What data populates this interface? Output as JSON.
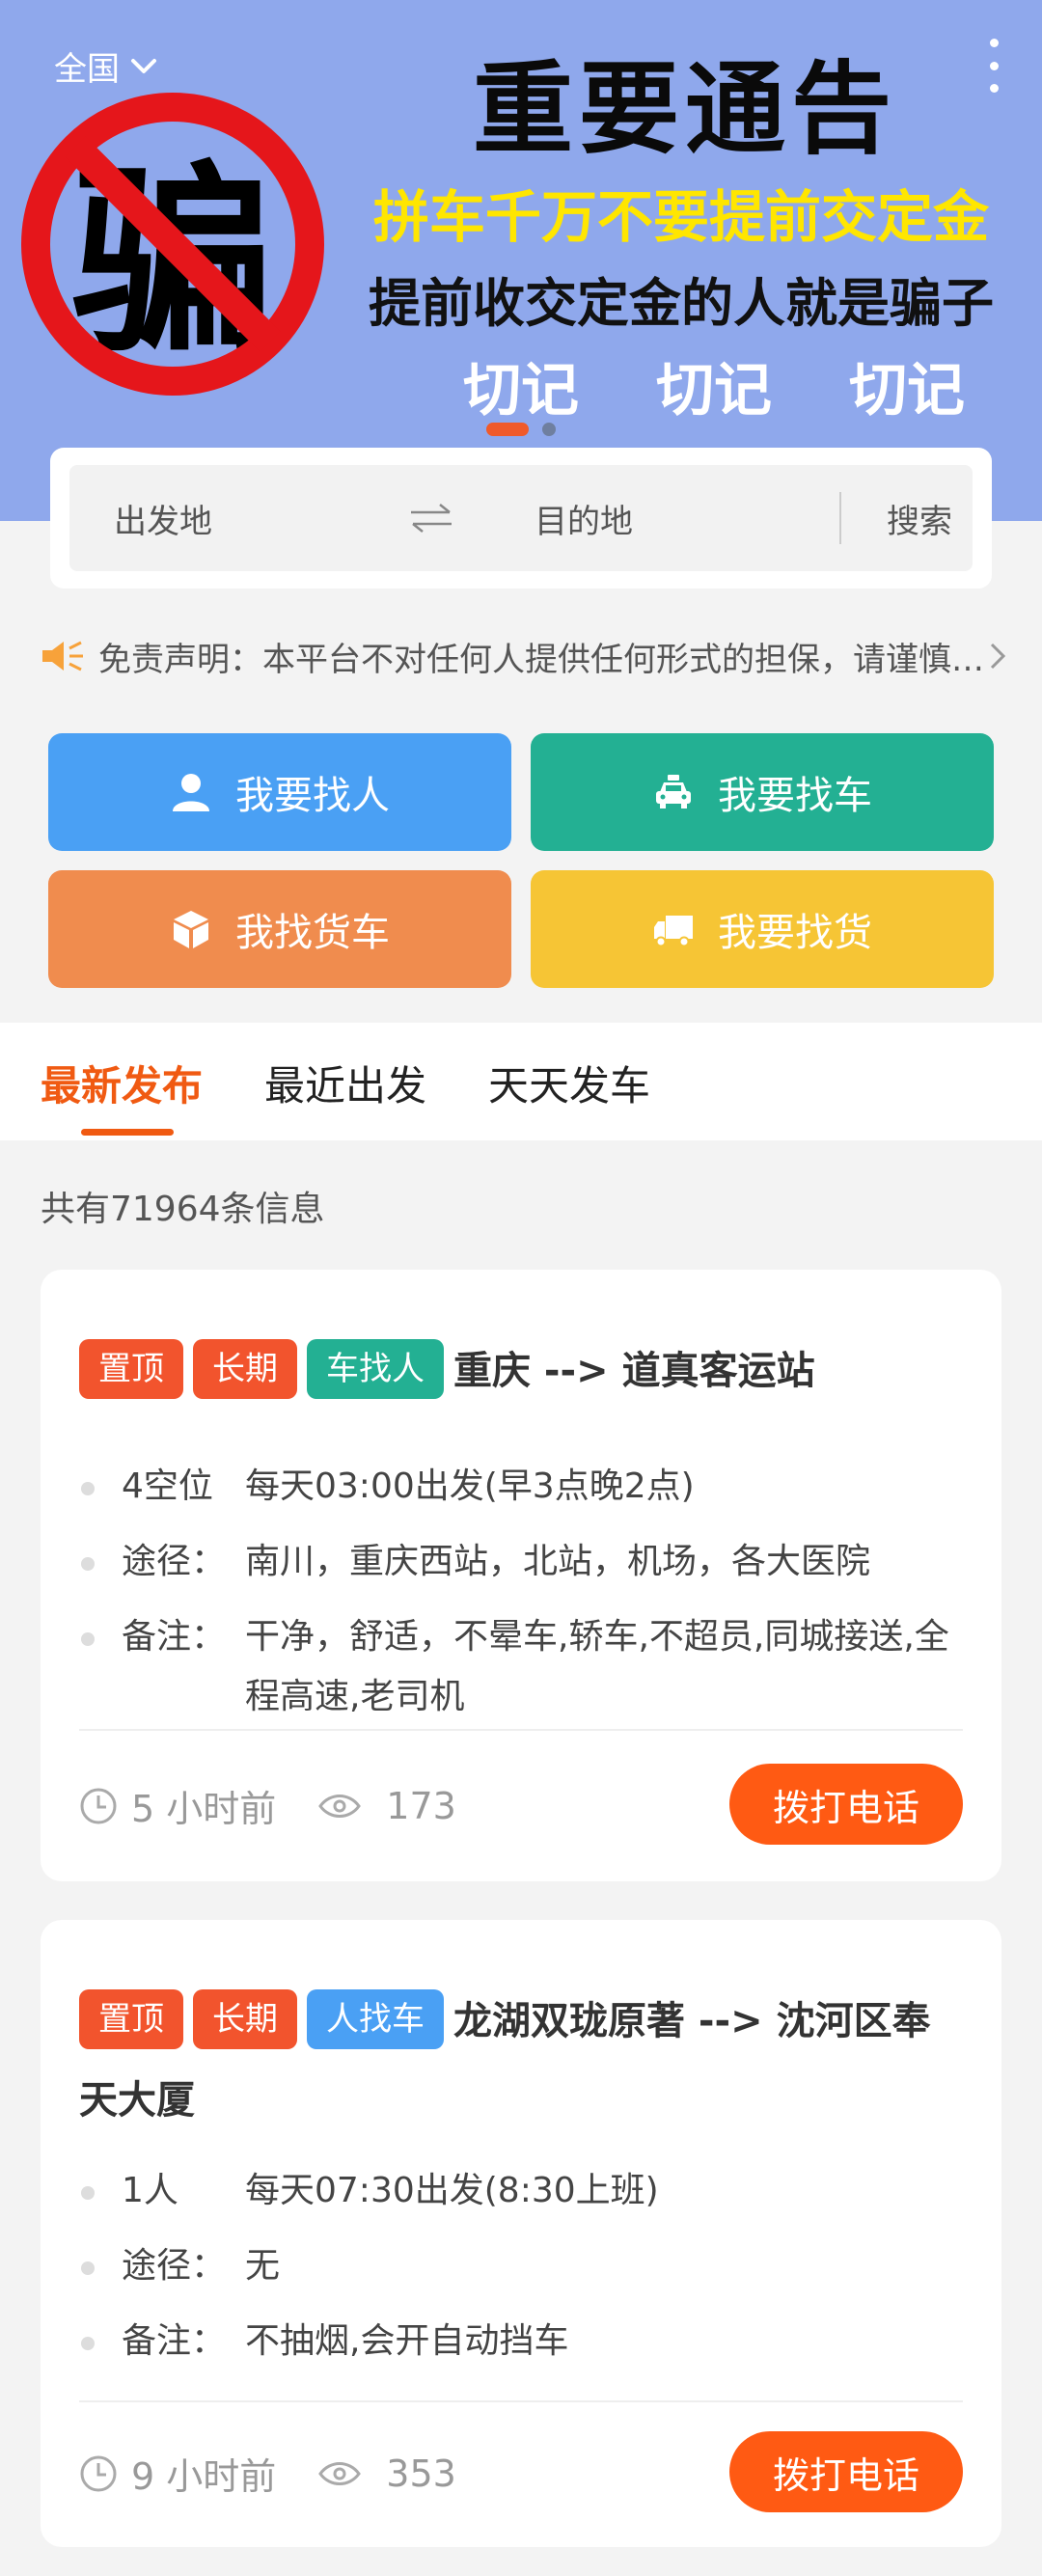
{
  "header": {
    "region_label": "全国",
    "banner": {
      "sign_char": "骗",
      "title": "重要通告",
      "line1": "拼车千万不要提前交定金",
      "line2": "提前收交定金的人就是骗子",
      "reminders": [
        "切记",
        "切记",
        "切记"
      ]
    }
  },
  "search": {
    "from_placeholder": "出发地",
    "to_placeholder": "目的地",
    "button_label": "搜索"
  },
  "disclaimer": {
    "text": "免责声明：本平台不对任何人提供任何形式的担保，请谨慎交易"
  },
  "actions": [
    {
      "label": "我要找人",
      "icon": "person-icon",
      "color": "#4aa0f4"
    },
    {
      "label": "我要找车",
      "icon": "taxi-icon",
      "color": "#23b093"
    },
    {
      "label": "我找货车",
      "icon": "box-icon",
      "color": "#f08c4e"
    },
    {
      "label": "我要找货",
      "icon": "truck-icon",
      "color": "#f6c535"
    }
  ],
  "tabs": [
    {
      "label": "最新发布",
      "active": true
    },
    {
      "label": "最近出发",
      "active": false
    },
    {
      "label": "天天发车",
      "active": false
    }
  ],
  "info_count": "共有71964条信息",
  "listings": [
    {
      "tags": [
        "置顶",
        "长期",
        "车找人"
      ],
      "route": "重庆 --> 道真客运站",
      "seats": "4空位",
      "schedule": "每天03:00出发(早3点晚2点)",
      "via_label": "途径：",
      "via": "南川，重庆西站，北站，机场，各大医院",
      "note_label": "备注：",
      "note": "干净，舒适，不晕车,轿车,不超员,同城接送,全程高速,老司机",
      "posted": "5 小时前",
      "views": "173",
      "call_label": "拨打电话"
    },
    {
      "tags": [
        "置顶",
        "长期",
        "人找车"
      ],
      "route": "龙湖双珑原著 --> 沈河区奉天大厦",
      "seats": "1人",
      "schedule": "每天07:30出发(8:30上班)",
      "via_label": "途径：",
      "via": "无",
      "note_label": "备注：",
      "note": "不抽烟,会开自动挡车",
      "posted": "9 小时前",
      "views": "353",
      "call_label": "拨打电话"
    }
  ],
  "colors": {
    "accent": "#f05a12",
    "banner_bg": "#8fa8ec",
    "tag_red": "#f2542d",
    "tag_green": "#23b093",
    "tag_blue": "#4aa0f4",
    "call_button": "#ff5a13"
  }
}
